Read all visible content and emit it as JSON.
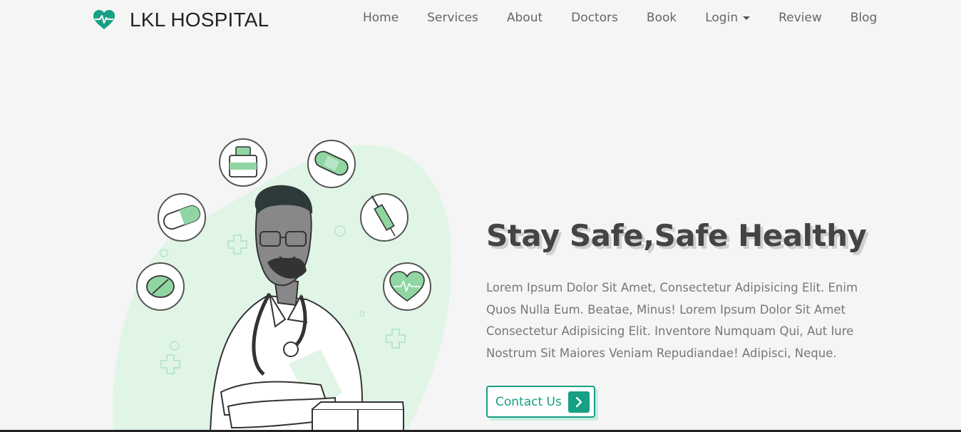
{
  "brand": {
    "name": "LKL HOSPITAL",
    "icon": "heartbeat-icon",
    "color": "#16a085"
  },
  "nav": {
    "items": [
      {
        "label": "Home"
      },
      {
        "label": "Services"
      },
      {
        "label": "About"
      },
      {
        "label": "Doctors"
      },
      {
        "label": "Book"
      },
      {
        "label": "Login",
        "has_dropdown": true
      },
      {
        "label": "Review"
      },
      {
        "label": "Blog"
      }
    ]
  },
  "hero": {
    "title": "Stay Safe,Safe Healthy",
    "text": "Lorem Ipsum Dolor Sit Amet, Consectetur Adipisicing Elit. Enim Quos Nulla Eum. Beatae, Minus! Lorem Ipsum Dolor Sit Amet Consectetur Adipisicing Elit. Inventore Numquam Qui, Aut Iure Nostrum Sit Maiores Veniam Repudiandae! Adipisci, Neque.",
    "button_label": "Contact Us",
    "button_icon": "chevron-right-icon"
  },
  "colors": {
    "accent": "#16a085",
    "blob": "#e0f5e6",
    "background": "#f5f5f5"
  }
}
